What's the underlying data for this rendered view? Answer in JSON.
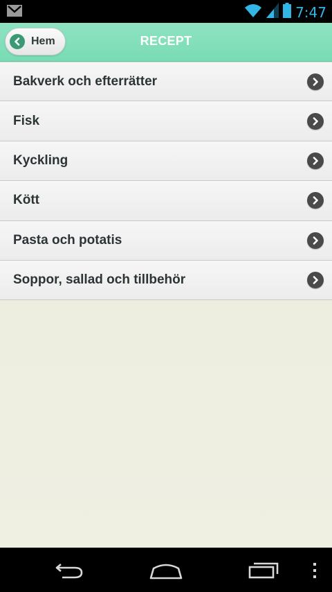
{
  "status_bar": {
    "time": "7:47",
    "icons": [
      "gmail-icon",
      "wifi-icon",
      "signal-icon",
      "battery-icon"
    ]
  },
  "header": {
    "back_label": "Hem",
    "title": "RECEPT"
  },
  "list": {
    "items": [
      {
        "label": "Bakverk och efterrätter"
      },
      {
        "label": "Fisk"
      },
      {
        "label": "Kyckling"
      },
      {
        "label": "Kött"
      },
      {
        "label": "Pasta och potatis"
      },
      {
        "label": "Soppor, sallad och tillbehör"
      }
    ]
  },
  "nav_bar": {
    "buttons": [
      "back-nav-icon",
      "home-nav-icon",
      "recent-apps-icon",
      "menu-overflow-icon"
    ]
  },
  "colors": {
    "header": "#79dbb4",
    "back_circle": "#3a9a75",
    "status_accent": "#33b5e5",
    "background": "#ecece0"
  }
}
